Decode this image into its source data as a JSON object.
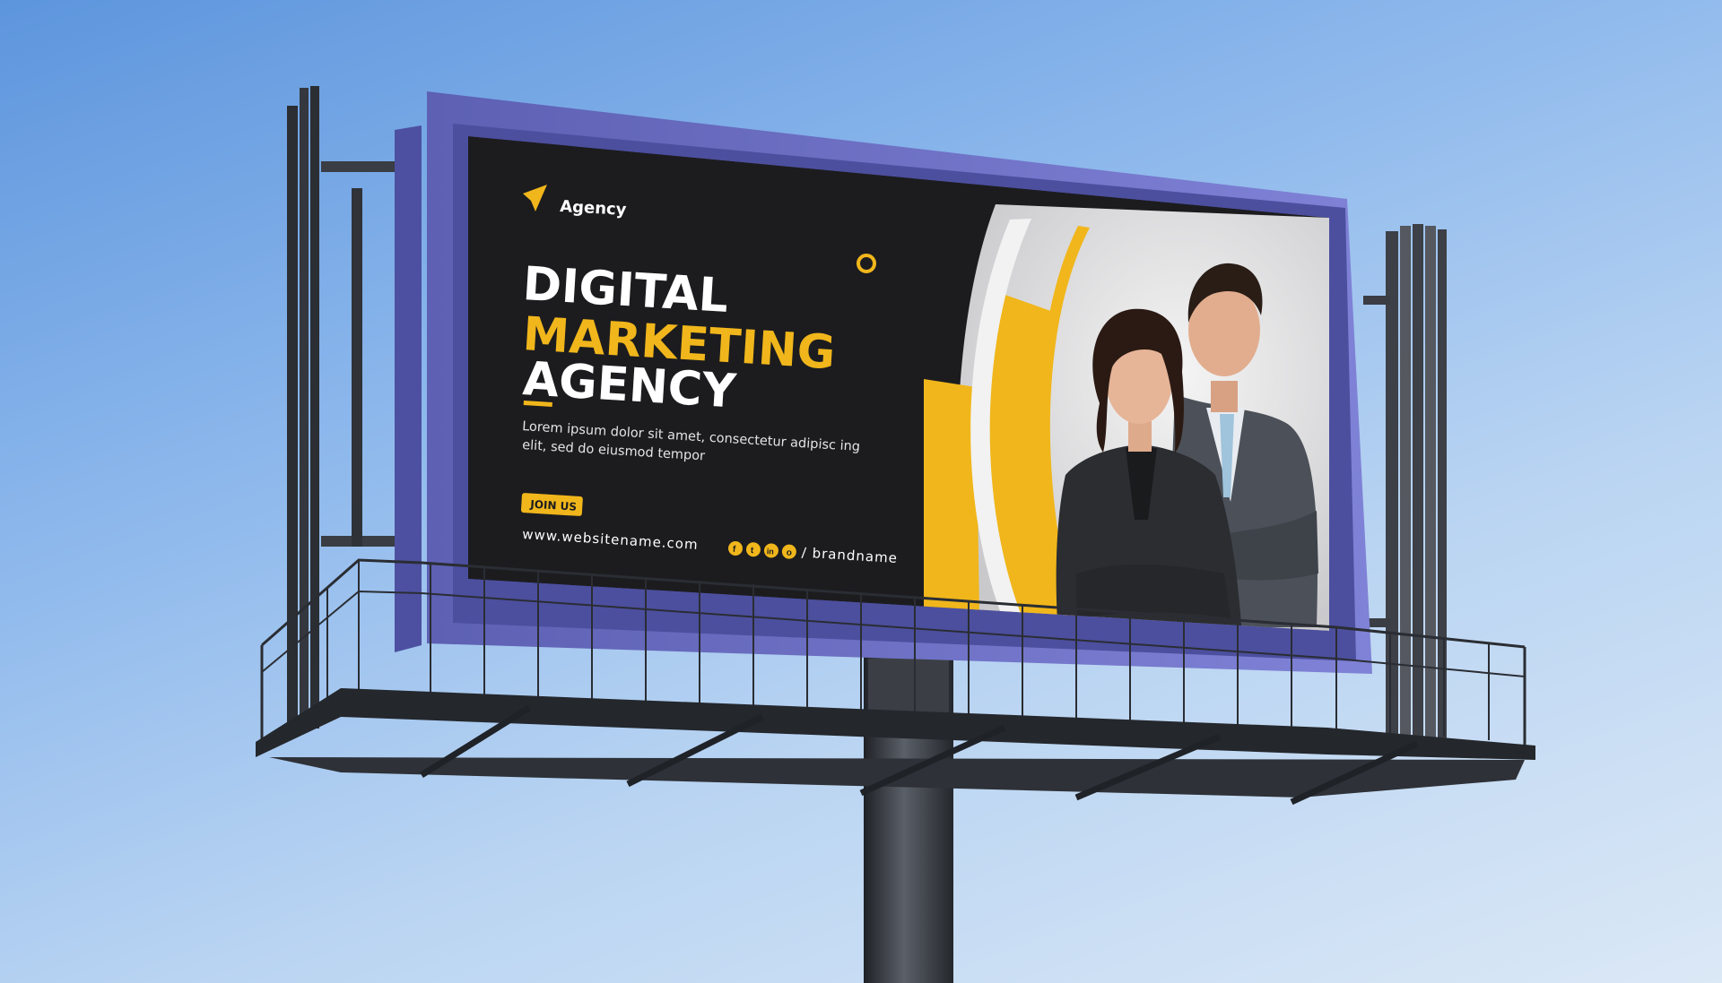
{
  "billboard": {
    "brand": "Agency",
    "headline": {
      "line1": "DIGITAL",
      "line2": "MARKETING",
      "line3": "AGENCY"
    },
    "body_line1": "Lorem ipsum dolor sit amet, consectetur adipisc ing",
    "body_line2": "elit, sed do eiusmod tempor",
    "cta_label": "JOIN US",
    "website": "www.websitename.com",
    "social_handle": "/ brandname",
    "social_icons": [
      "facebook-icon",
      "twitter-icon",
      "linkedin-icon",
      "instagram-icon"
    ],
    "social_glyphs": [
      "f",
      "t",
      "in",
      "o"
    ]
  },
  "colors": {
    "accent": "#f0b61b",
    "ad_background": "#1c1c1f",
    "frame": "#6f72c6",
    "photo_background": "#e6e6e6",
    "structure": "#2a2d33"
  }
}
